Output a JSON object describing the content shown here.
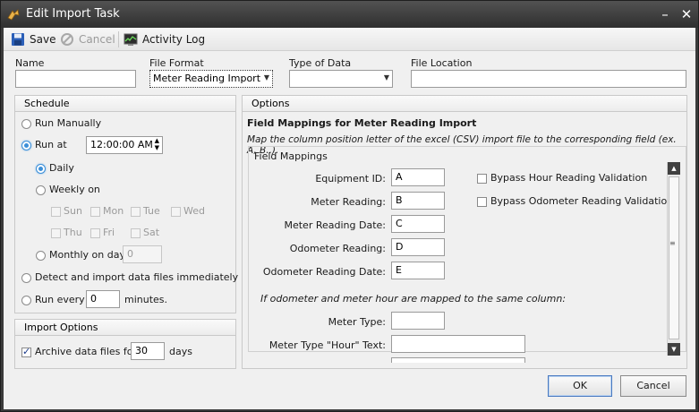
{
  "window": {
    "title": "Edit Import Task",
    "minimize": "–",
    "close": "✕"
  },
  "toolbar": {
    "save": "Save",
    "cancel": "Cancel",
    "activity_log": "Activity Log"
  },
  "fields": {
    "name_label": "Name",
    "name_value": "",
    "file_format_label": "File Format",
    "file_format_value": "Meter Reading Import",
    "type_of_data_label": "Type of Data",
    "type_of_data_value": "",
    "file_location_label": "File Location",
    "file_location_value": ""
  },
  "schedule": {
    "title": "Schedule",
    "run_manually": "Run Manually",
    "run_at": "Run at",
    "run_at_time": "12:00:00 AM",
    "daily": "Daily",
    "weekly_on": "Weekly on",
    "days": [
      "Sun",
      "Mon",
      "Tue",
      "Wed",
      "Thu",
      "Fri",
      "Sat"
    ],
    "monthly_on_day": "Monthly on day",
    "monthly_day_value": "0",
    "detect": "Detect and import data files immediately",
    "run_every": "Run every",
    "run_every_value": "0",
    "minutes": "minutes."
  },
  "import_options": {
    "title": "Import Options",
    "archive_label": "Archive data files for",
    "archive_value": "30",
    "days": "days"
  },
  "options": {
    "title": "Options",
    "heading": "Field Mappings for Meter Reading Import",
    "description": "Map the column position letter of the excel (CSV) import file to the corresponding field (ex. A, B..).",
    "group_title": "Field Mappings",
    "mappings": [
      {
        "label": "Equipment ID:",
        "value": "A"
      },
      {
        "label": "Meter Reading:",
        "value": "B"
      },
      {
        "label": "Meter Reading Date:",
        "value": "C"
      },
      {
        "label": "Odometer Reading:",
        "value": "D"
      },
      {
        "label": "Odometer Reading Date:",
        "value": "E"
      }
    ],
    "bypass_hour": "Bypass Hour Reading Validation",
    "bypass_odometer": "Bypass Odometer Reading Validation",
    "same_column_note": "If odometer and meter hour are mapped to the same column:",
    "meter_type_label": "Meter Type:",
    "meter_type_value": "",
    "meter_type_hour_label": "Meter Type \"Hour\" Text:",
    "meter_type_hour_value": ""
  },
  "buttons": {
    "ok": "OK",
    "cancel": "Cancel"
  },
  "colors": {
    "titlebar": "#3a3a3a",
    "accent": "#3c8fd8",
    "panel": "#f0f0f0"
  }
}
